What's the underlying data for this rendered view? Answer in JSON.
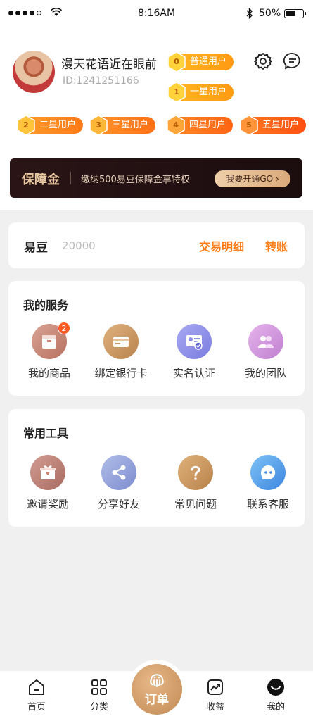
{
  "status_bar": {
    "time": "8:16AM",
    "battery": "50%"
  },
  "profile": {
    "name": "漫天花语近在眼前",
    "id": "ID:1241251166",
    "badges": [
      {
        "num": "0",
        "label": "普通用户"
      },
      {
        "num": "1",
        "label": "一星用户"
      },
      {
        "num": "2",
        "label": "二星用户"
      },
      {
        "num": "3",
        "label": "三星用户"
      },
      {
        "num": "4",
        "label": "四星用户"
      },
      {
        "num": "5",
        "label": "五星用户"
      }
    ]
  },
  "deposit": {
    "title": "保障金",
    "text": "缴纳500易豆保障金享特权",
    "button": "我要开通GO ›"
  },
  "bean": {
    "label": "易豆",
    "value": "20000",
    "detail": "交易明细",
    "transfer": "转账"
  },
  "services": {
    "title": "我的服务",
    "items": [
      {
        "label": "我的商品",
        "badge": "2"
      },
      {
        "label": "绑定银行卡"
      },
      {
        "label": "实名认证"
      },
      {
        "label": "我的团队"
      }
    ]
  },
  "tools": {
    "title": "常用工具",
    "items": [
      {
        "label": "邀请奖励"
      },
      {
        "label": "分享好友"
      },
      {
        "label": "常见问题"
      },
      {
        "label": "联系客服"
      }
    ]
  },
  "nav": {
    "home": "首页",
    "category": "分类",
    "order": "订单",
    "earnings": "收益",
    "mine": "我的"
  },
  "colors": {
    "accent": "#ff7c14",
    "badge": "#ffa516",
    "deposit_bg": "#1f0f10",
    "gold": "#d9a97a"
  }
}
